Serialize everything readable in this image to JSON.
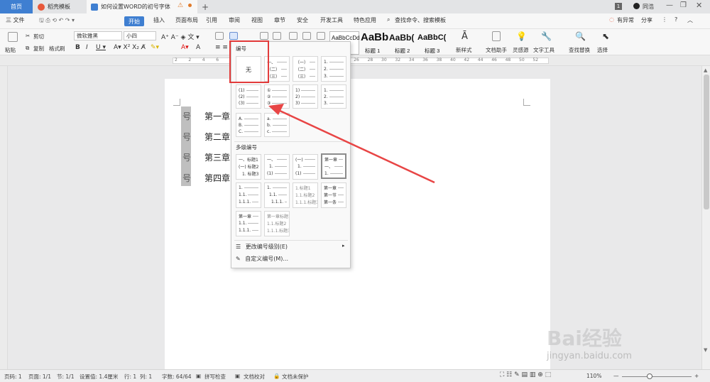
{
  "tabs": {
    "home": "首页",
    "template": "稻壳模板",
    "doc": "如何设置WORD的初号字体",
    "plus": "+"
  },
  "topright": {
    "badge": "1",
    "user": "同浩"
  },
  "menu": {
    "file": "三 文件",
    "start": "开始",
    "items": [
      "插入",
      "页面布局",
      "引用",
      "审阅",
      "视图",
      "章节",
      "安全",
      "开发工具",
      "特色应用"
    ],
    "search": "查找命令、搜索模板",
    "changes": "有异常",
    "share": "分享"
  },
  "ribbon": {
    "paste": "粘贴",
    "cut": "剪切",
    "copy": "复制",
    "format_painter": "格式刷",
    "font_name": "微软雅黑",
    "font_size": "小四",
    "style_preview_1": "AaBbCcDd",
    "style_preview_2": "AaBb",
    "style_preview_3": "AaBb(",
    "style_preview_4": "AaBbC(",
    "style_1_label": "标题 1",
    "style_2_label": "标题 2",
    "style_3_label": "标题 3",
    "new_style": "新样式",
    "doc_helper": "文档助手",
    "inspiration": "灵感源",
    "text_tools": "文字工具",
    "find_replace": "查找替换",
    "select": "选择"
  },
  "document": {
    "chapters": [
      "第一章",
      "第二章",
      "第三章",
      "第四章"
    ],
    "suffix": "号"
  },
  "dropdown": {
    "numbering_title": "编号",
    "none_label": "无",
    "multilevel_title": "多级编号",
    "change_level": "更改编号级别(E)",
    "custom": "自定义编号(M)...",
    "cells": {
      "c1": [
        "一、",
        "（二）",
        "（三）"
      ],
      "c2": [
        "（一）",
        "（二）",
        "（三）"
      ],
      "c3": [
        "1.",
        "2.",
        "3."
      ],
      "c4": [
        "(1)",
        "(2)",
        "(3)"
      ],
      "c5": [
        "①",
        "②",
        "③"
      ],
      "c6": [
        "1)",
        "2)",
        "3)"
      ],
      "c7": [
        "1.",
        "2.",
        "3."
      ],
      "c8": [
        "A.",
        "B.",
        "C."
      ],
      "c9": [
        "a.",
        "b.",
        "c."
      ]
    },
    "multi": {
      "m1": [
        "一、标题1",
        "(一) 标题2",
        "1. 标题3"
      ],
      "m2": [
        "一、",
        "1.",
        "(1)"
      ],
      "m3": [
        "(一)",
        "1.",
        "(1)"
      ],
      "m4": [
        "第一章",
        "一、",
        "1."
      ],
      "m5": [
        "1.",
        "1.1.",
        "1.1.1."
      ],
      "m6": [
        "1.",
        "1.1.",
        "1.1.1."
      ],
      "m7": [
        "1.标题1",
        "1.1.标题2",
        "1.1.1.标题3"
      ],
      "m8": [
        "第一章",
        "第一节",
        "第一条"
      ],
      "m9": [
        "第一章",
        "1.1.",
        "1.1.1."
      ],
      "m10": [
        "第一章标题1",
        "1.1.标题2",
        "1.1.1.标题3"
      ]
    }
  },
  "ruler_labels": [
    "2",
    "2",
    "4",
    "6",
    "8",
    "10",
    "12",
    "14",
    "16",
    "18",
    "20",
    "22",
    "24",
    "26",
    "28",
    "30",
    "32",
    "34",
    "36",
    "38",
    "40",
    "42",
    "44",
    "46",
    "48",
    "50",
    "52"
  ],
  "status": {
    "page": "页码: 1",
    "pages": "页面: 1/1",
    "section": "节: 1/1",
    "setting": "设置值: 1.4厘米",
    "row": "行: 1",
    "col": "列: 1",
    "words": "字数: 64/64",
    "spell": "拼写检查",
    "proof": "文档校对",
    "protect": "文档未保护",
    "zoom": "110%"
  },
  "watermark": {
    "brand": "Bai经验",
    "url": "jingyan.baidu.com"
  },
  "colors": {
    "accent": "#3f7fd1",
    "highlight_box": "#e23b3b",
    "arrow": "#e84545"
  }
}
